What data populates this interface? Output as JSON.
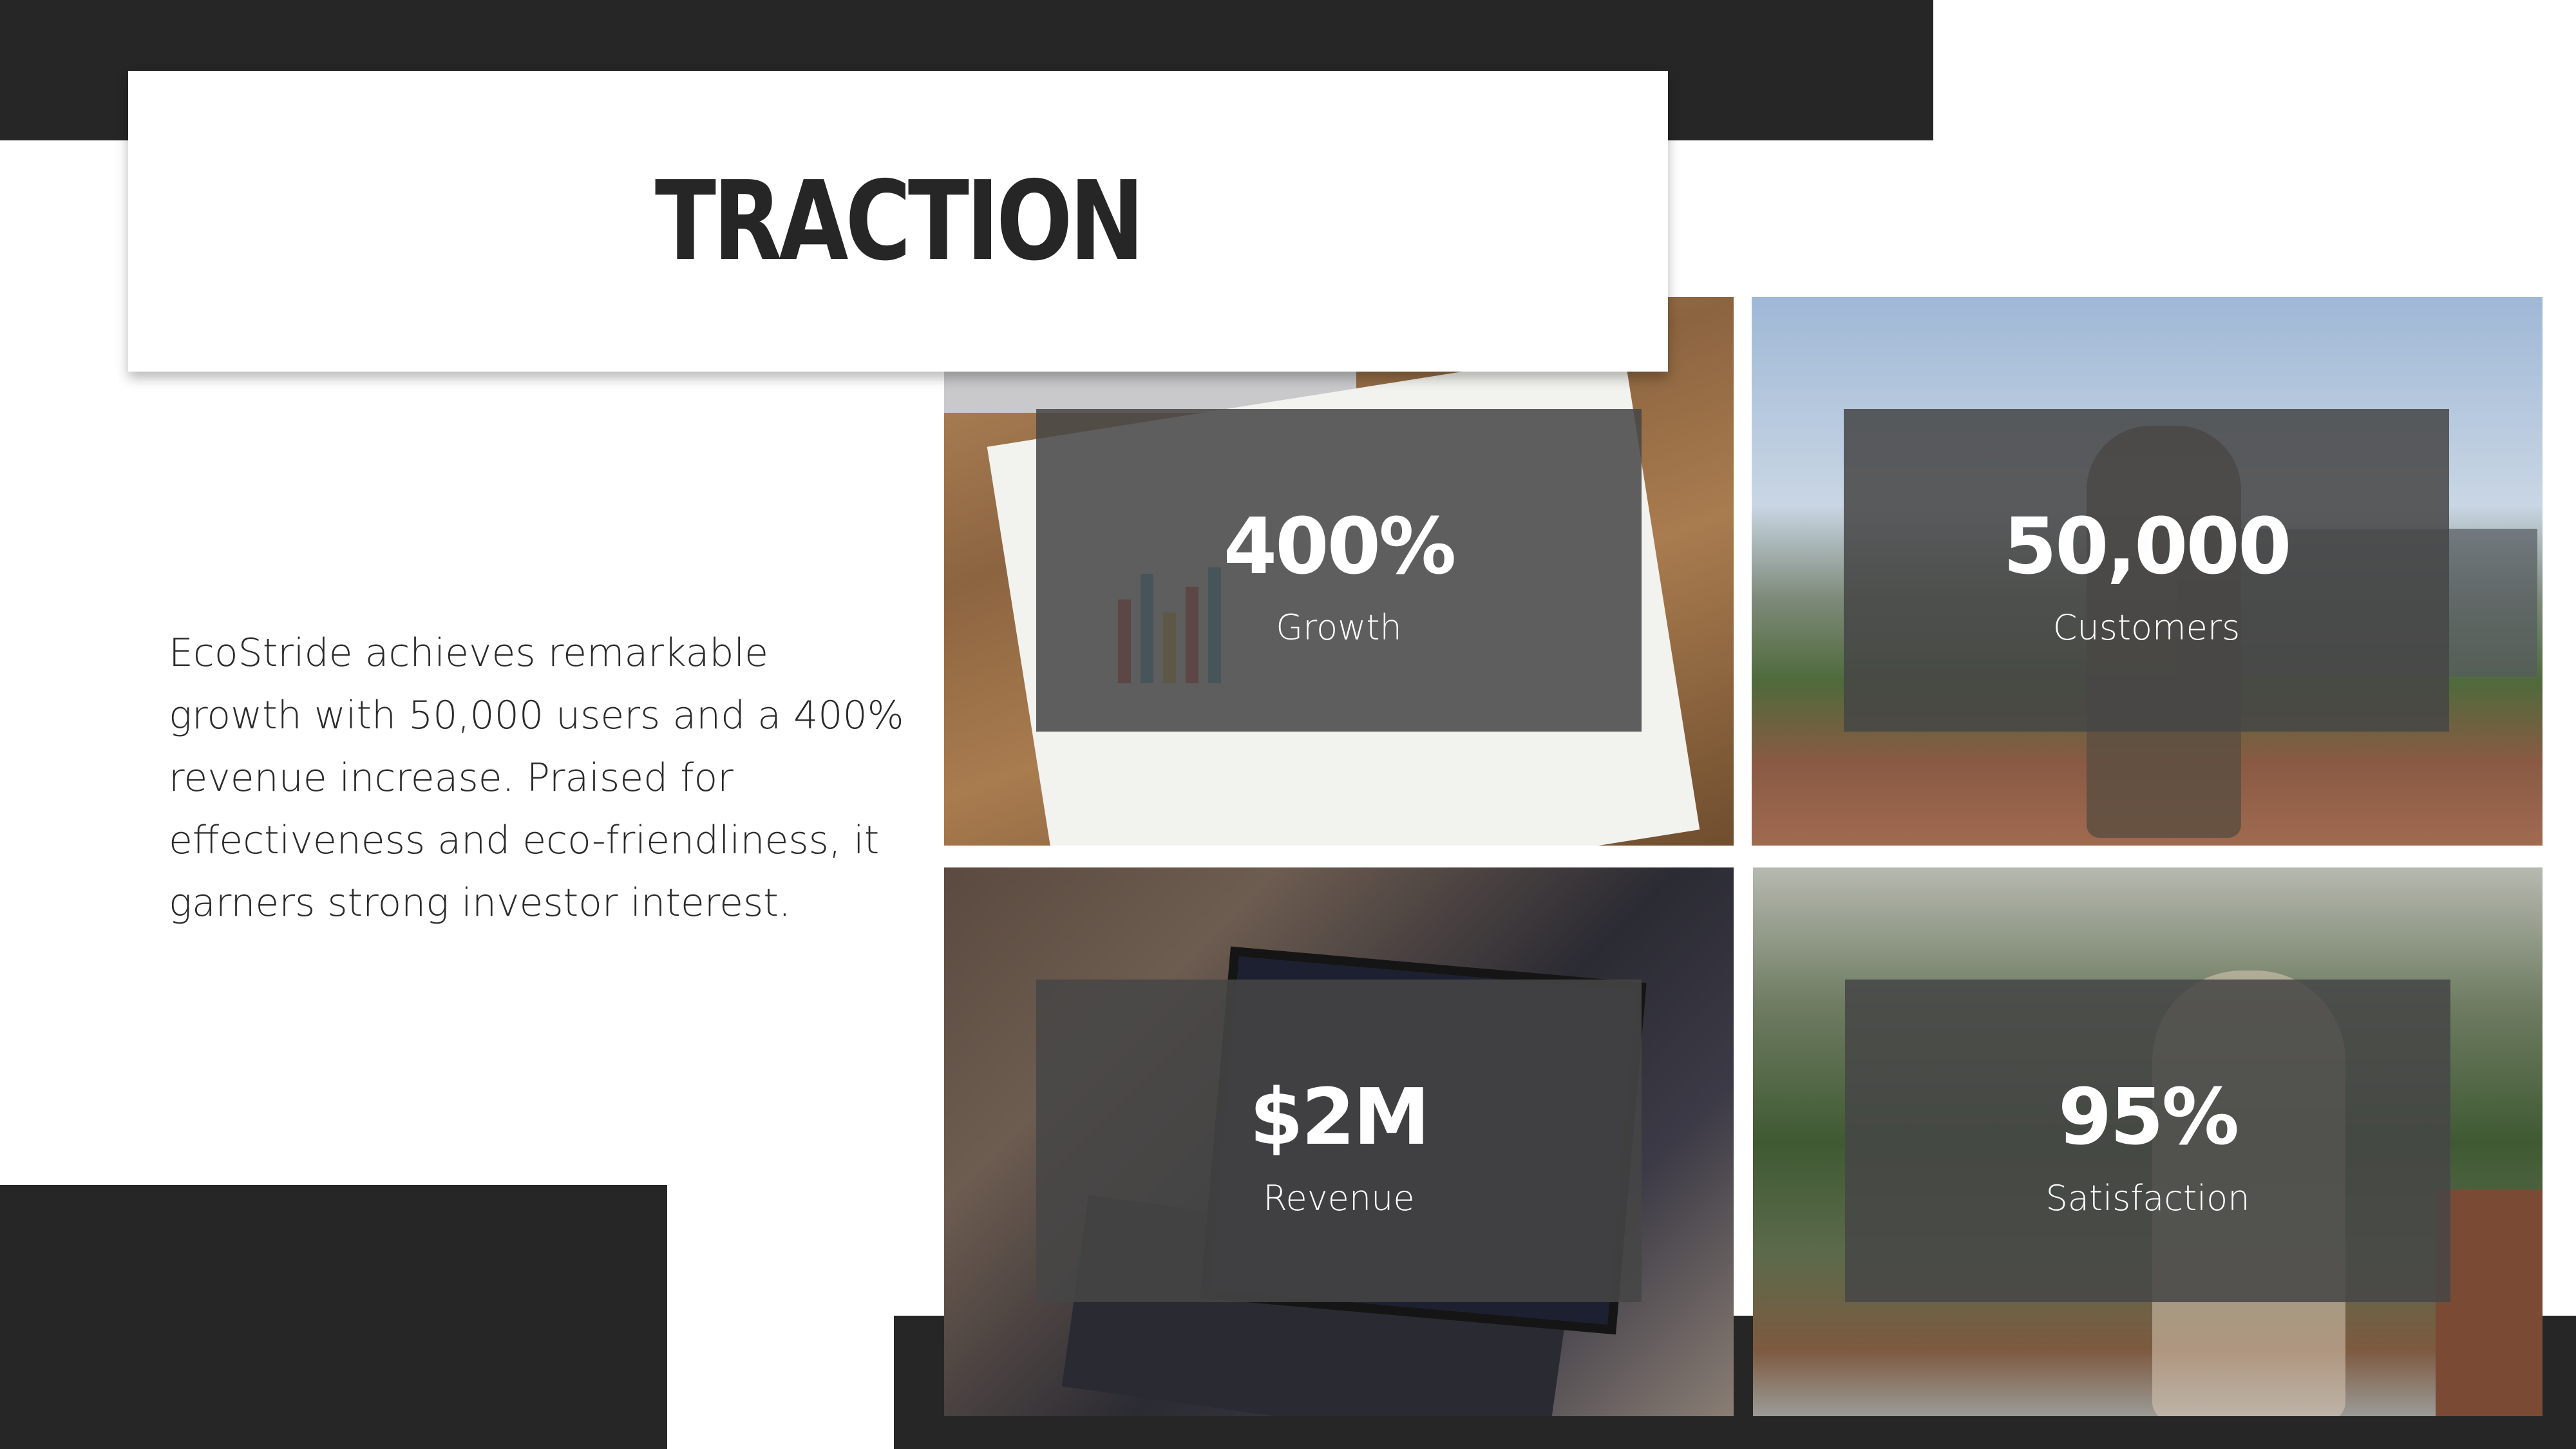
{
  "slide": {
    "title": "TRACTION",
    "body": "EcoStride achieves remarkable growth with 50,000 users and a 400% revenue increase. Praised for effectiveness and eco-friendliness, it garners strong investor interest."
  },
  "stats": [
    {
      "value": "400%",
      "label": "Growth"
    },
    {
      "value": "50,000",
      "label": "Customers"
    },
    {
      "value": "$2M",
      "label": "Revenue"
    },
    {
      "value": "95%",
      "label": "Satisfaction"
    }
  ],
  "colors": {
    "dark": "#262626",
    "overlay": "#464646",
    "background": "#ffffff"
  }
}
